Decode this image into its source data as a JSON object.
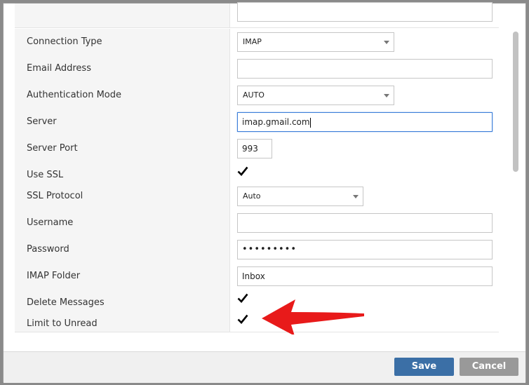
{
  "form": {
    "rows": [
      {
        "label": "Connection Type",
        "value": "IMAP"
      },
      {
        "label": "Email Address",
        "value": ""
      },
      {
        "label": "Authentication Mode",
        "value": "AUTO"
      },
      {
        "label": "Server",
        "value": "imap.gmail.com"
      },
      {
        "label": "Server Port",
        "value": "993"
      },
      {
        "label": "Use SSL",
        "checked": true
      },
      {
        "label": "SSL Protocol",
        "value": "Auto"
      },
      {
        "label": "Username",
        "value": ""
      },
      {
        "label": "Password",
        "value": "•••••••••"
      },
      {
        "label": "IMAP Folder",
        "value": "Inbox"
      },
      {
        "label": "Delete Messages",
        "checked": true
      },
      {
        "label": "Limit to Unread",
        "checked": true
      }
    ]
  },
  "footer": {
    "save_label": "Save",
    "cancel_label": "Cancel"
  },
  "colors": {
    "save_button": "#3b6fa6",
    "cancel_button": "#999999",
    "annotation_arrow": "#e81a1a"
  },
  "icons": {
    "check": "checkmark-icon",
    "dropdown": "chevron-down-icon",
    "annotation": "red-arrow-annotation"
  }
}
